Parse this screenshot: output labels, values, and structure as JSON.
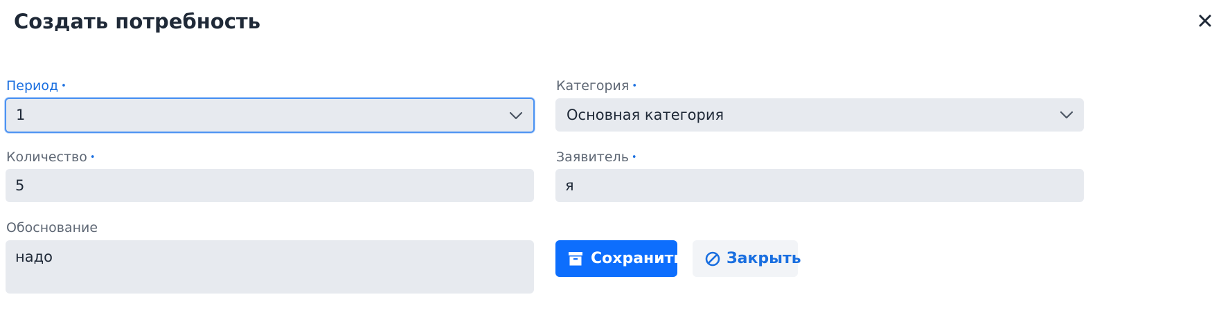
{
  "dialog": {
    "title": "Создать потребность",
    "close_label": "×"
  },
  "form": {
    "period": {
      "label": "Период",
      "required_mark": "•",
      "value": "1"
    },
    "category": {
      "label": "Категория",
      "required_mark": "•",
      "value": "Основная категория"
    },
    "quantity": {
      "label": "Количество",
      "required_mark": "•",
      "value": "5"
    },
    "applicant": {
      "label": "Заявитель",
      "required_mark": "•",
      "value": "я"
    },
    "justification": {
      "label": "Обоснование",
      "value": "надо"
    }
  },
  "actions": {
    "save_label": "Сохранить",
    "close_label": "Закрыть"
  },
  "icons": {
    "close": "close-icon",
    "chevron": "chevron-down-icon",
    "save": "archive-box-icon",
    "cancel": "ban-icon"
  },
  "colors": {
    "accent": "#1a6fe0",
    "primary_button": "#0d6efd",
    "input_background": "#e7eaef",
    "focus_border": "#4d93f2"
  }
}
